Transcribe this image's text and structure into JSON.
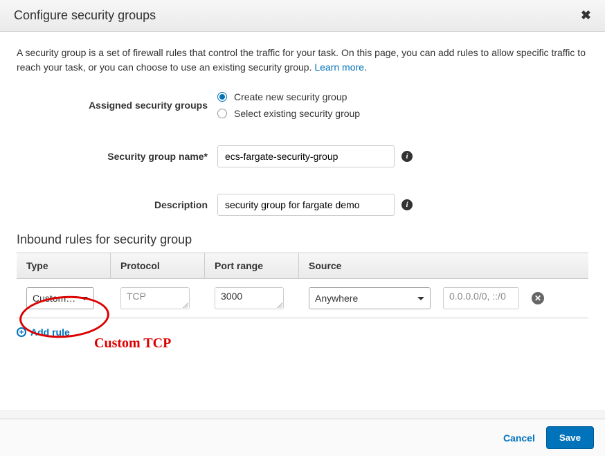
{
  "header": {
    "title": "Configure security groups"
  },
  "intro": {
    "text": "A security group is a set of firewall rules that control the traffic for your task. On this page, you can add rules to allow specific traffic to reach your task, or you can choose to use an existing security group. ",
    "learnMore": "Learn more"
  },
  "form": {
    "assignedLabel": "Assigned security groups",
    "radioCreate": "Create new security group",
    "radioSelect": "Select existing security group",
    "nameLabel": "Security group name*",
    "nameValue": "ecs-fargate-security-group",
    "descLabel": "Description",
    "descValue": "security group for fargate demo"
  },
  "rules": {
    "sectionTitle": "Inbound rules for security group",
    "headers": {
      "type": "Type",
      "protocol": "Protocol",
      "port": "Port range",
      "source": "Source"
    },
    "row": {
      "type": "Custom…",
      "protocol": "TCP",
      "port": "3000",
      "source": "Anywhere",
      "cidr": "0.0.0.0/0, ::/0"
    },
    "addRule": "Add rule"
  },
  "annotation": {
    "label": "Custom TCP"
  },
  "footer": {
    "cancel": "Cancel",
    "save": "Save"
  }
}
